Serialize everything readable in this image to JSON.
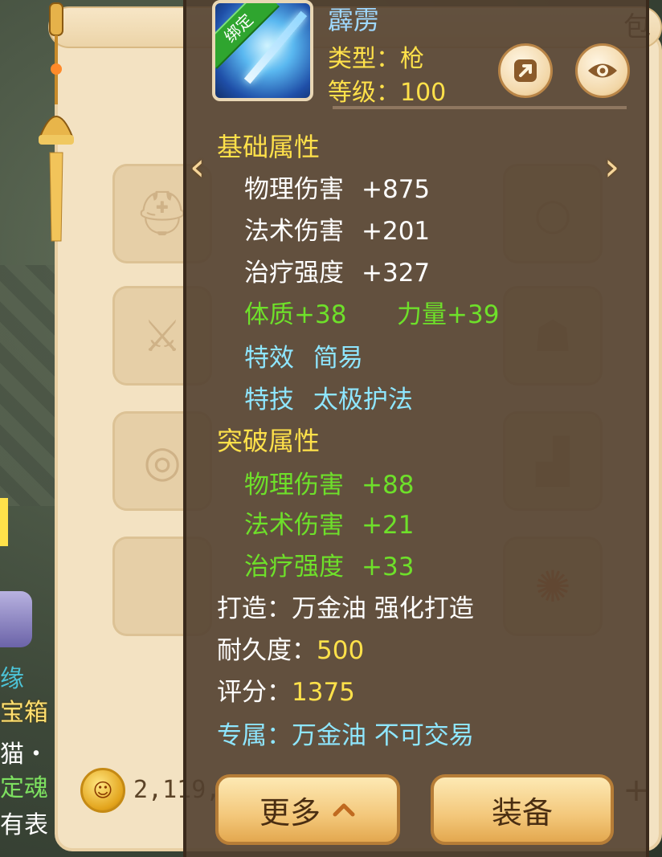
{
  "bag": {
    "title": "包",
    "gold_amount": "2,119,",
    "plus_label": "+"
  },
  "side_texts": {
    "yuan": "缘",
    "box": "宝箱",
    "cat": "猫・",
    "soul": "定魂",
    "has": "有表"
  },
  "item": {
    "bind_label": "绑定",
    "name": "霹雳",
    "type_line": "类型：枪",
    "level_line": "等级：100"
  },
  "base_attrs": {
    "title": "基础属性",
    "rows": [
      {
        "label": "物理伤害",
        "value": "+875"
      },
      {
        "label": "法术伤害",
        "value": "+201"
      },
      {
        "label": "治疗强度",
        "value": "+327"
      }
    ],
    "extra_left": "体质+38",
    "extra_right": "力量+39",
    "effect_label": "特效",
    "effect_value": "简易",
    "skill_label": "特技",
    "skill_value": "太极护法"
  },
  "break_attrs": {
    "title": "突破属性",
    "rows": [
      {
        "label": "物理伤害",
        "value": "+88"
      },
      {
        "label": "法术伤害",
        "value": "+21"
      },
      {
        "label": "治疗强度",
        "value": "+33"
      }
    ]
  },
  "forge": {
    "label": "打造：",
    "value": "万金油  强化打造"
  },
  "durability": {
    "label": "耐久度：",
    "value": "500"
  },
  "score": {
    "label": "评分：",
    "value": "1375"
  },
  "exclusive": {
    "label": "专属：",
    "value": "万金油  不可交易"
  },
  "buttons": {
    "more": "更多",
    "equip": "装备"
  },
  "colors": {
    "title_yellow": "#ffe14a",
    "attr_green": "#6ee02a",
    "name_blue": "#9fd8ff",
    "panel_brown": "#524030"
  },
  "icons": [
    "share-icon",
    "eye-icon",
    "arrow-left-icon",
    "arrow-right-icon",
    "chevron-up-icon",
    "gold-coin-icon"
  ]
}
